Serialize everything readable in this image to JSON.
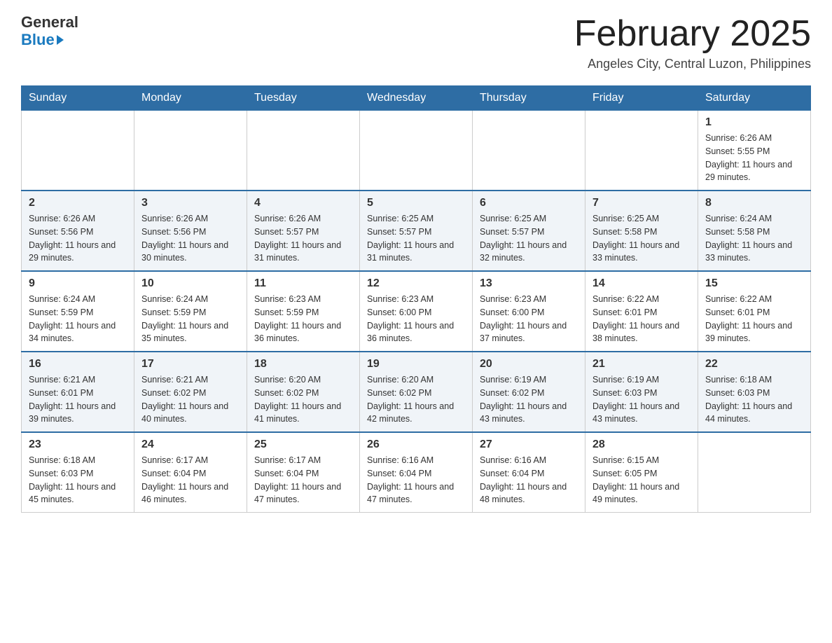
{
  "header": {
    "logo_general": "General",
    "logo_blue": "Blue",
    "month_title": "February 2025",
    "location": "Angeles City, Central Luzon, Philippines"
  },
  "days_of_week": [
    "Sunday",
    "Monday",
    "Tuesday",
    "Wednesday",
    "Thursday",
    "Friday",
    "Saturday"
  ],
  "weeks": [
    {
      "days": [
        {
          "num": "",
          "info": ""
        },
        {
          "num": "",
          "info": ""
        },
        {
          "num": "",
          "info": ""
        },
        {
          "num": "",
          "info": ""
        },
        {
          "num": "",
          "info": ""
        },
        {
          "num": "",
          "info": ""
        },
        {
          "num": "1",
          "info": "Sunrise: 6:26 AM\nSunset: 5:55 PM\nDaylight: 11 hours and 29 minutes."
        }
      ]
    },
    {
      "days": [
        {
          "num": "2",
          "info": "Sunrise: 6:26 AM\nSunset: 5:56 PM\nDaylight: 11 hours and 29 minutes."
        },
        {
          "num": "3",
          "info": "Sunrise: 6:26 AM\nSunset: 5:56 PM\nDaylight: 11 hours and 30 minutes."
        },
        {
          "num": "4",
          "info": "Sunrise: 6:26 AM\nSunset: 5:57 PM\nDaylight: 11 hours and 31 minutes."
        },
        {
          "num": "5",
          "info": "Sunrise: 6:25 AM\nSunset: 5:57 PM\nDaylight: 11 hours and 31 minutes."
        },
        {
          "num": "6",
          "info": "Sunrise: 6:25 AM\nSunset: 5:57 PM\nDaylight: 11 hours and 32 minutes."
        },
        {
          "num": "7",
          "info": "Sunrise: 6:25 AM\nSunset: 5:58 PM\nDaylight: 11 hours and 33 minutes."
        },
        {
          "num": "8",
          "info": "Sunrise: 6:24 AM\nSunset: 5:58 PM\nDaylight: 11 hours and 33 minutes."
        }
      ]
    },
    {
      "days": [
        {
          "num": "9",
          "info": "Sunrise: 6:24 AM\nSunset: 5:59 PM\nDaylight: 11 hours and 34 minutes."
        },
        {
          "num": "10",
          "info": "Sunrise: 6:24 AM\nSunset: 5:59 PM\nDaylight: 11 hours and 35 minutes."
        },
        {
          "num": "11",
          "info": "Sunrise: 6:23 AM\nSunset: 5:59 PM\nDaylight: 11 hours and 36 minutes."
        },
        {
          "num": "12",
          "info": "Sunrise: 6:23 AM\nSunset: 6:00 PM\nDaylight: 11 hours and 36 minutes."
        },
        {
          "num": "13",
          "info": "Sunrise: 6:23 AM\nSunset: 6:00 PM\nDaylight: 11 hours and 37 minutes."
        },
        {
          "num": "14",
          "info": "Sunrise: 6:22 AM\nSunset: 6:01 PM\nDaylight: 11 hours and 38 minutes."
        },
        {
          "num": "15",
          "info": "Sunrise: 6:22 AM\nSunset: 6:01 PM\nDaylight: 11 hours and 39 minutes."
        }
      ]
    },
    {
      "days": [
        {
          "num": "16",
          "info": "Sunrise: 6:21 AM\nSunset: 6:01 PM\nDaylight: 11 hours and 39 minutes."
        },
        {
          "num": "17",
          "info": "Sunrise: 6:21 AM\nSunset: 6:02 PM\nDaylight: 11 hours and 40 minutes."
        },
        {
          "num": "18",
          "info": "Sunrise: 6:20 AM\nSunset: 6:02 PM\nDaylight: 11 hours and 41 minutes."
        },
        {
          "num": "19",
          "info": "Sunrise: 6:20 AM\nSunset: 6:02 PM\nDaylight: 11 hours and 42 minutes."
        },
        {
          "num": "20",
          "info": "Sunrise: 6:19 AM\nSunset: 6:02 PM\nDaylight: 11 hours and 43 minutes."
        },
        {
          "num": "21",
          "info": "Sunrise: 6:19 AM\nSunset: 6:03 PM\nDaylight: 11 hours and 43 minutes."
        },
        {
          "num": "22",
          "info": "Sunrise: 6:18 AM\nSunset: 6:03 PM\nDaylight: 11 hours and 44 minutes."
        }
      ]
    },
    {
      "days": [
        {
          "num": "23",
          "info": "Sunrise: 6:18 AM\nSunset: 6:03 PM\nDaylight: 11 hours and 45 minutes."
        },
        {
          "num": "24",
          "info": "Sunrise: 6:17 AM\nSunset: 6:04 PM\nDaylight: 11 hours and 46 minutes."
        },
        {
          "num": "25",
          "info": "Sunrise: 6:17 AM\nSunset: 6:04 PM\nDaylight: 11 hours and 47 minutes."
        },
        {
          "num": "26",
          "info": "Sunrise: 6:16 AM\nSunset: 6:04 PM\nDaylight: 11 hours and 47 minutes."
        },
        {
          "num": "27",
          "info": "Sunrise: 6:16 AM\nSunset: 6:04 PM\nDaylight: 11 hours and 48 minutes."
        },
        {
          "num": "28",
          "info": "Sunrise: 6:15 AM\nSunset: 6:05 PM\nDaylight: 11 hours and 49 minutes."
        },
        {
          "num": "",
          "info": ""
        }
      ]
    }
  ]
}
